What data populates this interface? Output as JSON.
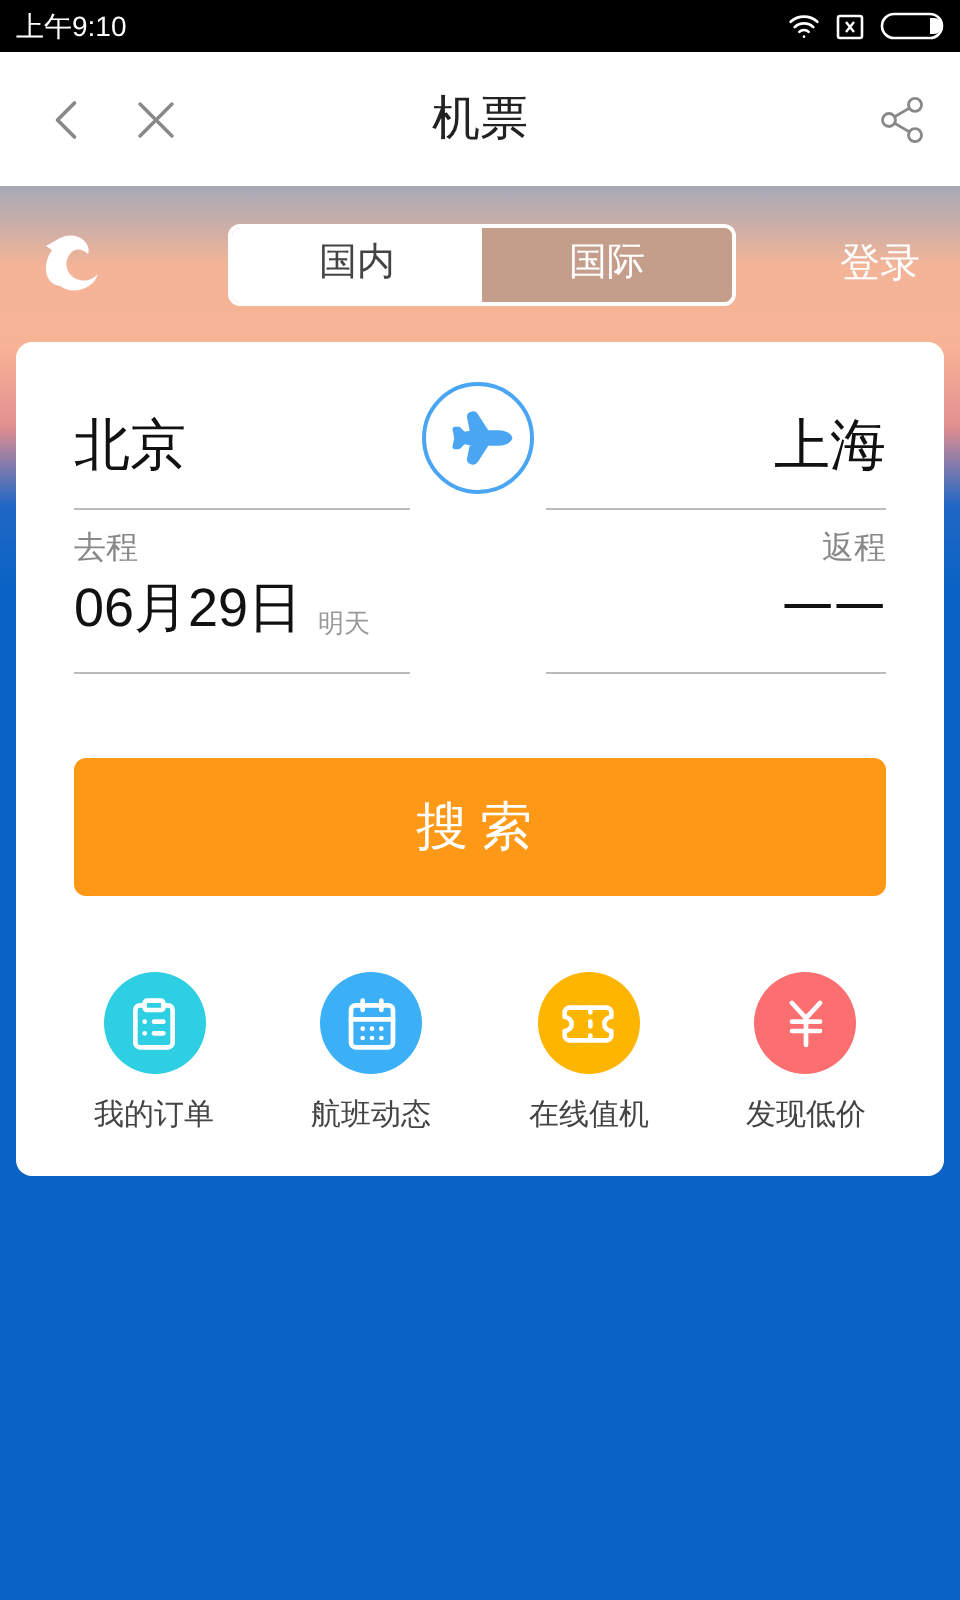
{
  "status_bar": {
    "time": "上午9:10"
  },
  "nav": {
    "title": "机票"
  },
  "tabs": [
    {
      "label": "国内",
      "selected": false
    },
    {
      "label": "国际",
      "selected": true
    }
  ],
  "login": "登录",
  "search_form": {
    "from": "北京",
    "to": "上海",
    "depart_label": "去程",
    "depart_date": "06月29日",
    "depart_note": "明天",
    "return_label": "返程",
    "return_date": "一一",
    "button": "搜索"
  },
  "shortcuts": [
    {
      "kind": "orders",
      "label": "我的订单",
      "color": "#2ecfe3"
    },
    {
      "kind": "flights",
      "label": "航班动态",
      "color": "#3cb0f7"
    },
    {
      "kind": "checkin",
      "label": "在线值机",
      "color": "#fdb500"
    },
    {
      "kind": "price",
      "label": "发现低价",
      "color": "#fc6f70"
    }
  ]
}
